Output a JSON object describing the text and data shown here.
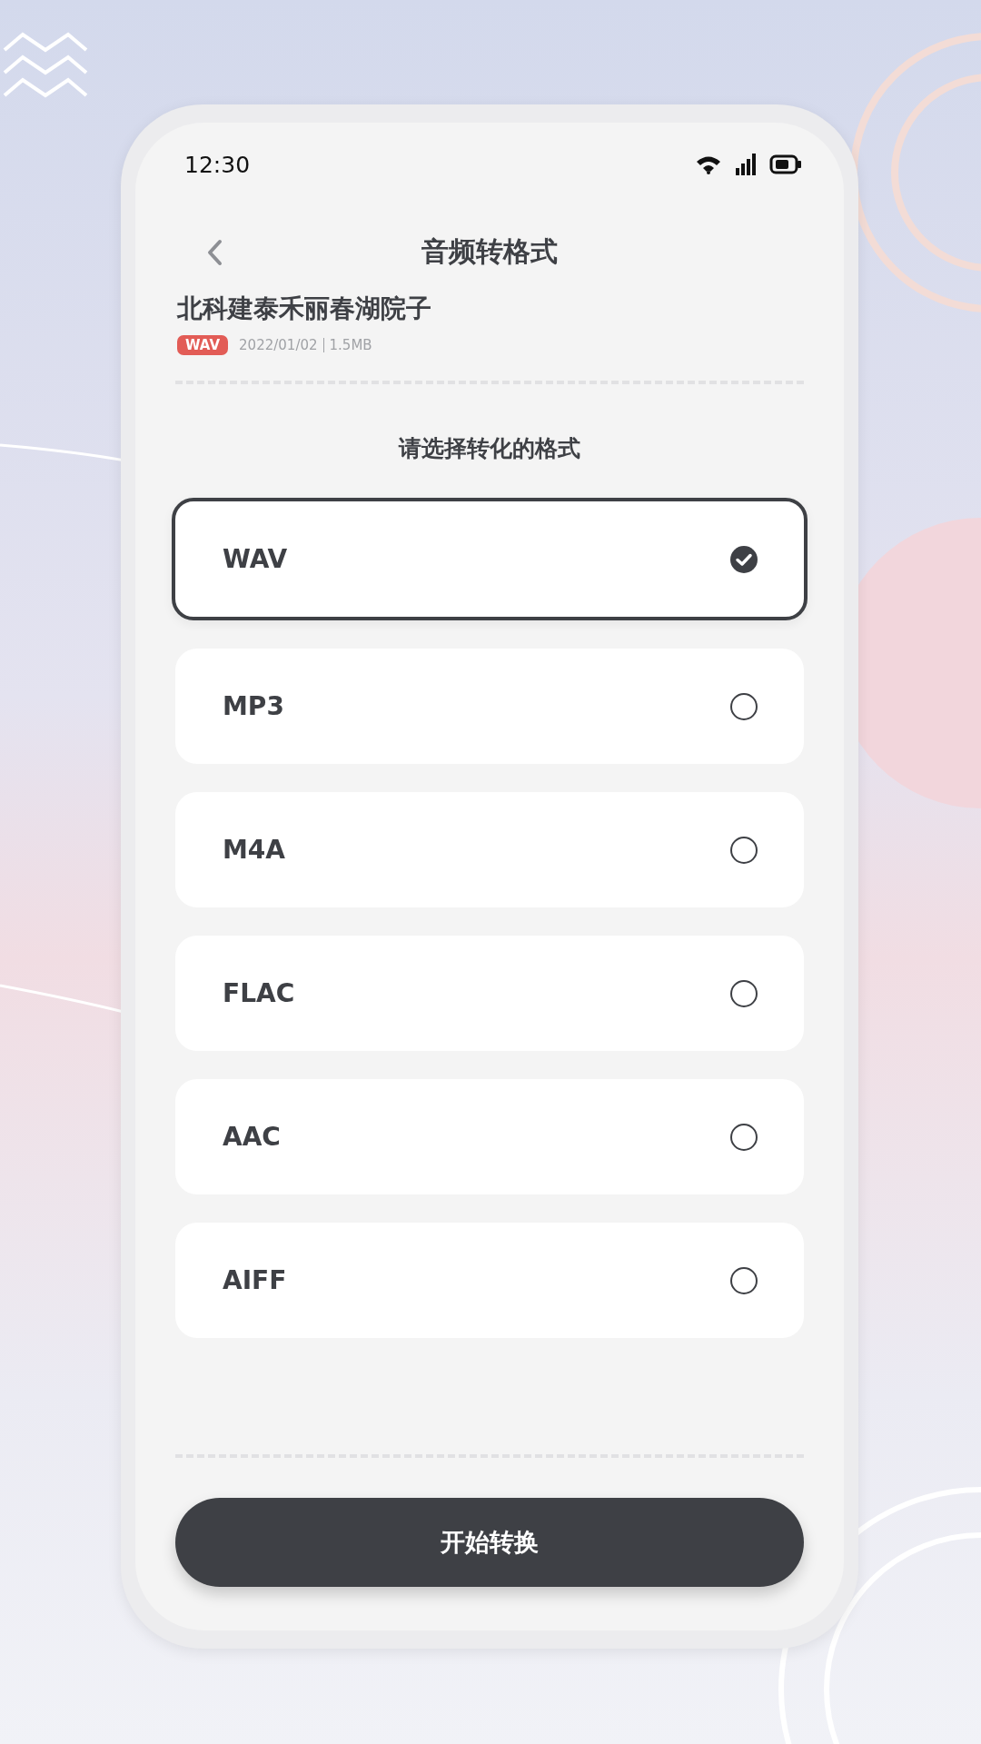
{
  "status_bar": {
    "time": "12:30"
  },
  "header": {
    "title": "音频转格式"
  },
  "file": {
    "name": "北科建泰禾丽春湖院子",
    "format_tag": "WAV",
    "date": "2022/01/02",
    "size": "1.5MB"
  },
  "prompt": "请选择转化的格式",
  "formats": [
    {
      "label": "WAV",
      "selected": true
    },
    {
      "label": "MP3",
      "selected": false
    },
    {
      "label": "M4A",
      "selected": false
    },
    {
      "label": "FLAC",
      "selected": false
    },
    {
      "label": "AAC",
      "selected": false
    },
    {
      "label": "AIFF",
      "selected": false
    }
  ],
  "convert_button": "开始转换"
}
